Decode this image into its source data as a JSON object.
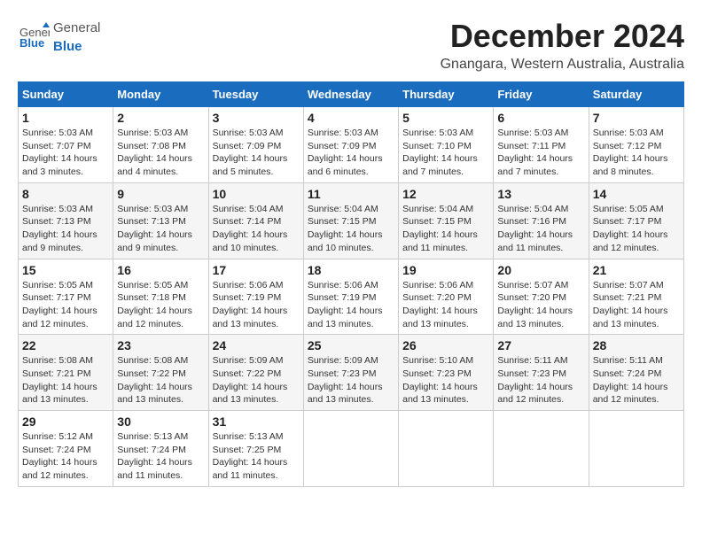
{
  "header": {
    "logo_general": "General",
    "logo_blue": "Blue",
    "month_title": "December 2024",
    "location": "Gnangara, Western Australia, Australia"
  },
  "days_of_week": [
    "Sunday",
    "Monday",
    "Tuesday",
    "Wednesday",
    "Thursday",
    "Friday",
    "Saturday"
  ],
  "weeks": [
    [
      {
        "day": "1",
        "sunrise": "5:03 AM",
        "sunset": "7:07 PM",
        "daylight": "14 hours and 3 minutes."
      },
      {
        "day": "2",
        "sunrise": "5:03 AM",
        "sunset": "7:08 PM",
        "daylight": "14 hours and 4 minutes."
      },
      {
        "day": "3",
        "sunrise": "5:03 AM",
        "sunset": "7:09 PM",
        "daylight": "14 hours and 5 minutes."
      },
      {
        "day": "4",
        "sunrise": "5:03 AM",
        "sunset": "7:09 PM",
        "daylight": "14 hours and 6 minutes."
      },
      {
        "day": "5",
        "sunrise": "5:03 AM",
        "sunset": "7:10 PM",
        "daylight": "14 hours and 7 minutes."
      },
      {
        "day": "6",
        "sunrise": "5:03 AM",
        "sunset": "7:11 PM",
        "daylight": "14 hours and 7 minutes."
      },
      {
        "day": "7",
        "sunrise": "5:03 AM",
        "sunset": "7:12 PM",
        "daylight": "14 hours and 8 minutes."
      }
    ],
    [
      {
        "day": "8",
        "sunrise": "5:03 AM",
        "sunset": "7:13 PM",
        "daylight": "14 hours and 9 minutes."
      },
      {
        "day": "9",
        "sunrise": "5:03 AM",
        "sunset": "7:13 PM",
        "daylight": "14 hours and 9 minutes."
      },
      {
        "day": "10",
        "sunrise": "5:04 AM",
        "sunset": "7:14 PM",
        "daylight": "14 hours and 10 minutes."
      },
      {
        "day": "11",
        "sunrise": "5:04 AM",
        "sunset": "7:15 PM",
        "daylight": "14 hours and 10 minutes."
      },
      {
        "day": "12",
        "sunrise": "5:04 AM",
        "sunset": "7:15 PM",
        "daylight": "14 hours and 11 minutes."
      },
      {
        "day": "13",
        "sunrise": "5:04 AM",
        "sunset": "7:16 PM",
        "daylight": "14 hours and 11 minutes."
      },
      {
        "day": "14",
        "sunrise": "5:05 AM",
        "sunset": "7:17 PM",
        "daylight": "14 hours and 12 minutes."
      }
    ],
    [
      {
        "day": "15",
        "sunrise": "5:05 AM",
        "sunset": "7:17 PM",
        "daylight": "14 hours and 12 minutes."
      },
      {
        "day": "16",
        "sunrise": "5:05 AM",
        "sunset": "7:18 PM",
        "daylight": "14 hours and 12 minutes."
      },
      {
        "day": "17",
        "sunrise": "5:06 AM",
        "sunset": "7:19 PM",
        "daylight": "14 hours and 13 minutes."
      },
      {
        "day": "18",
        "sunrise": "5:06 AM",
        "sunset": "7:19 PM",
        "daylight": "14 hours and 13 minutes."
      },
      {
        "day": "19",
        "sunrise": "5:06 AM",
        "sunset": "7:20 PM",
        "daylight": "14 hours and 13 minutes."
      },
      {
        "day": "20",
        "sunrise": "5:07 AM",
        "sunset": "7:20 PM",
        "daylight": "14 hours and 13 minutes."
      },
      {
        "day": "21",
        "sunrise": "5:07 AM",
        "sunset": "7:21 PM",
        "daylight": "14 hours and 13 minutes."
      }
    ],
    [
      {
        "day": "22",
        "sunrise": "5:08 AM",
        "sunset": "7:21 PM",
        "daylight": "14 hours and 13 minutes."
      },
      {
        "day": "23",
        "sunrise": "5:08 AM",
        "sunset": "7:22 PM",
        "daylight": "14 hours and 13 minutes."
      },
      {
        "day": "24",
        "sunrise": "5:09 AM",
        "sunset": "7:22 PM",
        "daylight": "14 hours and 13 minutes."
      },
      {
        "day": "25",
        "sunrise": "5:09 AM",
        "sunset": "7:23 PM",
        "daylight": "14 hours and 13 minutes."
      },
      {
        "day": "26",
        "sunrise": "5:10 AM",
        "sunset": "7:23 PM",
        "daylight": "14 hours and 13 minutes."
      },
      {
        "day": "27",
        "sunrise": "5:11 AM",
        "sunset": "7:23 PM",
        "daylight": "14 hours and 12 minutes."
      },
      {
        "day": "28",
        "sunrise": "5:11 AM",
        "sunset": "7:24 PM",
        "daylight": "14 hours and 12 minutes."
      }
    ],
    [
      {
        "day": "29",
        "sunrise": "5:12 AM",
        "sunset": "7:24 PM",
        "daylight": "14 hours and 12 minutes."
      },
      {
        "day": "30",
        "sunrise": "5:13 AM",
        "sunset": "7:24 PM",
        "daylight": "14 hours and 11 minutes."
      },
      {
        "day": "31",
        "sunrise": "5:13 AM",
        "sunset": "7:25 PM",
        "daylight": "14 hours and 11 minutes."
      },
      null,
      null,
      null,
      null
    ]
  ],
  "labels": {
    "sunrise": "Sunrise:",
    "sunset": "Sunset:",
    "daylight": "Daylight:"
  }
}
